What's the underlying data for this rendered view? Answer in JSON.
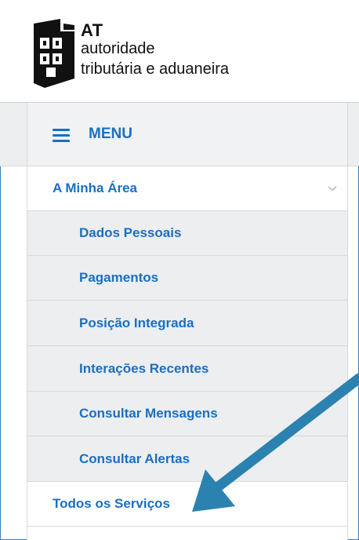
{
  "logo": {
    "abbr": "AT",
    "line1": "autoridade",
    "line2": "tributária e aduaneira"
  },
  "menu": {
    "label": "MENU",
    "icon": "hamburger-icon"
  },
  "nav": {
    "section": {
      "label": "A Minha Área",
      "expanded": true,
      "icon": "chevron-down-icon"
    },
    "subitems": [
      {
        "label": "Dados Pessoais"
      },
      {
        "label": "Pagamentos"
      },
      {
        "label": "Posição Integrada"
      },
      {
        "label": "Interações Recentes"
      },
      {
        "label": "Consultar Mensagens"
      },
      {
        "label": "Consultar Alertas"
      }
    ],
    "all_services": {
      "label": "Todos os Serviços"
    }
  },
  "colors": {
    "accent": "#1a6fc2",
    "arrow": "#2b82b1",
    "submenu_bg": "#eceeef"
  }
}
